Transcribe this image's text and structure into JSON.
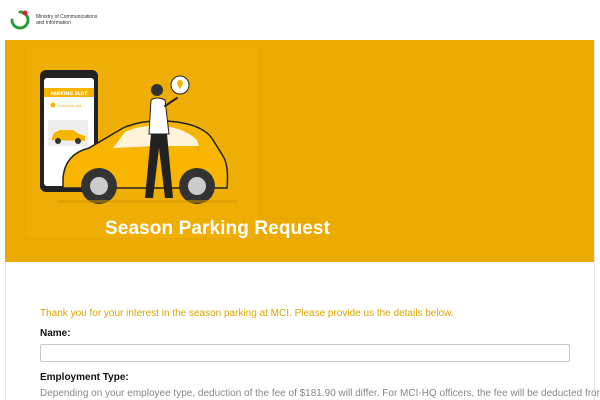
{
  "header": {
    "logo_text_line1": "Ministry of Communications",
    "logo_text_line2": "and Information"
  },
  "banner": {
    "title": "Season Parking Request",
    "illustration": {
      "phone_label": "PARKING SLOT",
      "phone_sub": "Available slot",
      "icon": "location-pin-icon"
    }
  },
  "form": {
    "intro": "Thank you for your interest in the season parking at MCI. Please provide us the details below.",
    "name_label": "Name:",
    "name_value": "",
    "name_placeholder": "",
    "employment_label": "Employment Type:",
    "employment_desc": "Depending on your employee type, deduction of the fee of $181.90 will differ. For MCI-HQ officers, the fee will be deducted from"
  },
  "colors": {
    "banner": "#eaaa00",
    "intro_text": "#d9a400",
    "car": "#f7b500"
  }
}
